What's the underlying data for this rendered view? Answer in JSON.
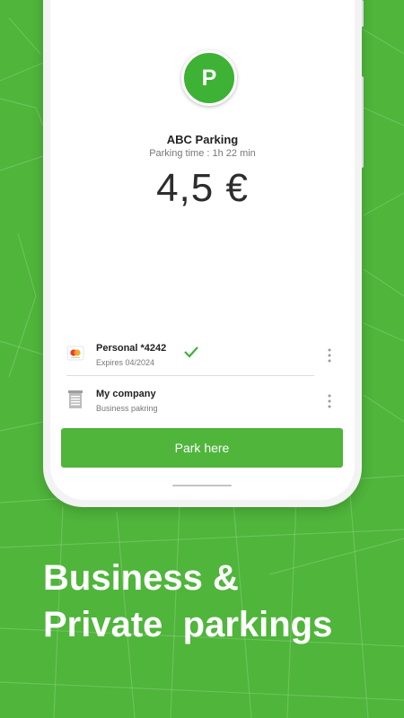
{
  "colors": {
    "background": "#4fb53b",
    "accent": "#3db234",
    "button": "#4fb53b"
  },
  "parking": {
    "badge": "P",
    "name": "ABC Parking",
    "time": "Parking time : 1h 22 min",
    "price": "4,5 €"
  },
  "payment_methods": [
    {
      "icon": "mastercard-icon",
      "title": "Personal *4242",
      "subtitle": "Expires 04/2024",
      "selected": true
    },
    {
      "icon": "company-building-icon",
      "title": "My company",
      "subtitle": "Business pakring",
      "selected": false
    }
  ],
  "actions": {
    "park_label": "Park here"
  },
  "headline": {
    "line1": "Business &",
    "line2": "Private  parkings"
  }
}
